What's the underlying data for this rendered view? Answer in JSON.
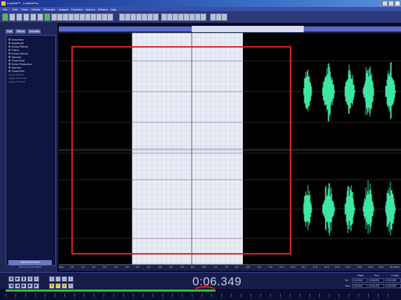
{
  "window": {
    "title": "CoolEdit™ - CoolEdit Pro"
  },
  "menu": [
    "File",
    "Edit",
    "View",
    "Effects",
    "Generate",
    "Analyze",
    "Favorites",
    "Options",
    "Window",
    "Help"
  ],
  "left_panel": {
    "tabs": [
      "Files",
      "Effects",
      "Favorites"
    ],
    "tree": [
      "Noiseless",
      "Amplitude",
      "Delay Effects",
      "Filters",
      "Delay Effects",
      "Special",
      "Time/Pitch",
      "Noise Reduction",
      "Special",
      "Time/Pitch"
    ],
    "tree_dim": [
      "Apply Brush",
      "Apply Reverse",
      "Apply Silence"
    ],
    "button_label": "Show Full Panels",
    "status_text": "Select to show effect"
  },
  "timecode": "0:06.349",
  "selection_info": {
    "headers": [
      "Begin",
      "End",
      "Length"
    ],
    "rows": [
      {
        "label": "Sel",
        "values": [
          "0:03.545",
          "0:08.000",
          "0:04.455"
        ]
      },
      {
        "label": "View",
        "values": [
          "0:00.000",
          "0:16.209",
          "0:16.209"
        ]
      }
    ]
  },
  "ruler_ticks": [
    "hms",
    "0.5",
    "1.0",
    "1.5",
    "2.0",
    "2.5",
    "3.0",
    "3.5",
    "4.0",
    "4.5",
    "5.0",
    "5.5",
    "6.0",
    "6.5",
    "7.0",
    "7.5",
    "8.0",
    "8.5",
    "9.0",
    "9.5",
    "10.0",
    "10.5",
    "11.0",
    "11.5",
    "12.0",
    "12.5",
    "13.0",
    "13.5",
    "14.0",
    "14.5",
    "15.0",
    "hms"
  ],
  "colors": {
    "waveform": "#3ee6a4",
    "selection": "#e8ecf5",
    "annotation": "#e02020",
    "background": "#000000"
  },
  "icons": [
    "app-icon",
    "minimize-icon",
    "maximize-icon",
    "close-icon",
    "play-icon",
    "stop-icon",
    "pause-icon",
    "record-icon",
    "loop-icon",
    "rewind-icon",
    "forward-icon",
    "zoom-in-icon",
    "zoom-out-icon"
  ]
}
